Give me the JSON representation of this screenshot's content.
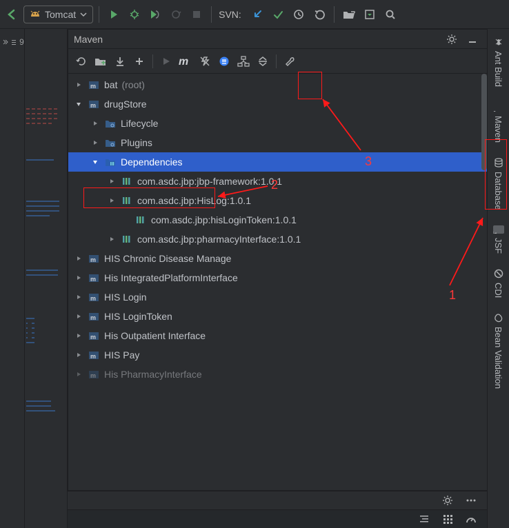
{
  "top": {
    "run_config": "Tomcat",
    "svn_label": "SVN:"
  },
  "gutter": {
    "num": "9"
  },
  "panel": {
    "title": "Maven"
  },
  "right_tabs": {
    "ant": "Ant Build",
    "maven": "Maven",
    "database": "Database",
    "jsf": "JSF",
    "cdi": "CDI",
    "bean": "Bean Validation"
  },
  "tree": {
    "bat": {
      "label": "bat",
      "suffix": "(root)"
    },
    "drugStore": {
      "label": "drugStore",
      "lifecycle": "Lifecycle",
      "plugins": "Plugins",
      "dependencies_label": "Dependencies",
      "deps": [
        "com.asdc.jbp:jbp-framework:1.0.1",
        "com.asdc.jbp:HisLog:1.0.1",
        "com.asdc.jbp:hisLoginToken:1.0.1",
        "com.asdc.jbp:pharmacyInterface:1.0.1"
      ]
    },
    "others": [
      "HIS Chronic Disease Manage",
      "His IntegratedPlatformInterface",
      "HIS Login",
      "HIS LoginToken",
      "His Outpatient Interface",
      "HIS Pay",
      "His PharmacyInterface"
    ]
  },
  "annotations": {
    "n1": "1",
    "n2": "2",
    "n3": "3"
  }
}
